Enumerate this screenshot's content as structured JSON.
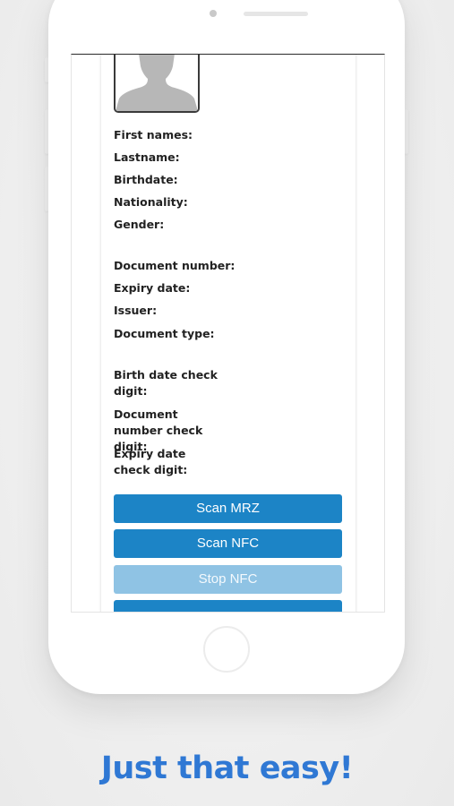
{
  "fields": {
    "first_names": "First names:",
    "lastname": "Lastname:",
    "birthdate": "Birthdate:",
    "nationality": "Nationality:",
    "gender": "Gender:",
    "document_number": "Document number:",
    "expiry_date": "Expiry date:",
    "issuer": "Issuer:",
    "document_type": "Document type:",
    "birth_date_check_digit": "Birth date check digit:",
    "document_number_check_digit": "Document number check digit:",
    "expiry_date_check_digit": "Expiry date check digit:"
  },
  "buttons": {
    "scan_mrz": "Scan MRZ",
    "scan_nfc": "Scan NFC",
    "stop_nfc": "Stop NFC"
  },
  "tagline": "Just that easy!",
  "colors": {
    "primary_button": "#1c84c6",
    "disabled_button": "#8fc3e4",
    "tagline": "#2f78d4"
  },
  "icons": {
    "portrait": "person-silhouette-icon"
  }
}
